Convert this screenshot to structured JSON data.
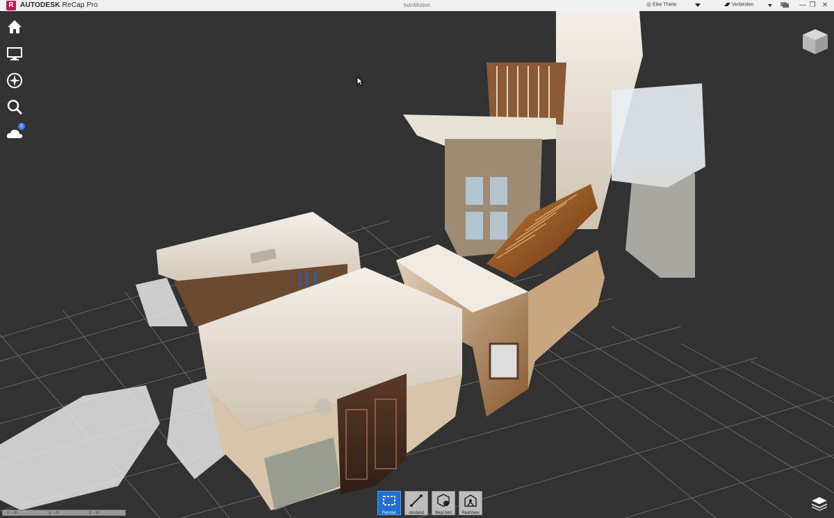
{
  "titlebar": {
    "logo_letter": "R",
    "brand": "AUTODESK",
    "product": "ReCap Pro",
    "document": "twinMotion",
    "user": "Eike Thiele",
    "connect": "Verbinden",
    "win_minimize": "—",
    "win_restore": "❐",
    "win_close": "✕"
  },
  "left_nav": [
    {
      "name": "home-icon"
    },
    {
      "name": "monitor-icon"
    },
    {
      "name": "compass-icon"
    },
    {
      "name": "search-icon"
    },
    {
      "name": "cloud-icon",
      "badge": "1"
    }
  ],
  "toolbar": {
    "tools": [
      {
        "label": "Fenster",
        "icon": "window-select-icon",
        "active": true
      },
      {
        "label": "Abstand",
        "icon": "measure-distance-icon",
        "active": false
      },
      {
        "label": "Begr.feld",
        "icon": "limit-box-icon",
        "active": false
      },
      {
        "label": "RealView",
        "icon": "realview-icon",
        "active": false
      }
    ]
  },
  "coords": {
    "x": "x: - m",
    "y": "y: - m",
    "z": "z: - m"
  },
  "colors": {
    "accent": "#1f6fd0",
    "background": "#323232",
    "brand": "#c3185c"
  }
}
